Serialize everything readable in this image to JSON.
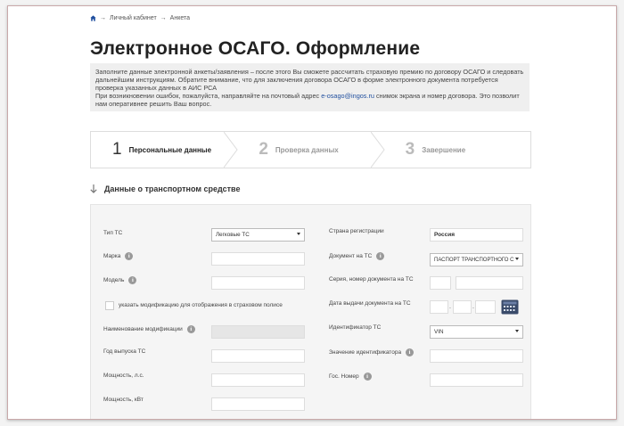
{
  "breadcrumb": {
    "separator": "→",
    "items": [
      "Личный кабинет",
      "Анкета"
    ]
  },
  "page": {
    "title": "Электронное ОСАГО. Оформление"
  },
  "notice": {
    "line1": "Заполните данные электронной анкеты/заявления – после этого Вы сможете рассчитать страховую премию по договору ОСАГО и следовать дальнейшим инструкциям. Обратите внимание, что для заключения договора ОСАГО в форме электронного документа потребуется проверка указанных данных в АИС РСА",
    "line2_prefix": "При возникновении ошибок, пожалуйста, направляйте на почтовый адрес ",
    "email": "e-osago@ingos.ru",
    "line2_suffix": " снимок экрана и номер договора. Это позволит нам оперативнее решить Ваш вопрос."
  },
  "steps": [
    {
      "num": "1",
      "label": "Персональные данные",
      "active": true
    },
    {
      "num": "2",
      "label": "Проверка данных",
      "active": false
    },
    {
      "num": "3",
      "label": "Завершение",
      "active": false
    }
  ],
  "section": {
    "title": "Данные о транспортном средстве"
  },
  "form": {
    "left": {
      "vehicle_type_label": "Тип ТС",
      "vehicle_type_value": "Легковые ТС",
      "make_label": "Марка",
      "model_label": "Модель",
      "modification_checkbox_label": "указать модификацию для отображения в страховом полисе",
      "modification_name_label": "Наименование модификации",
      "year_label": "Год выпуска ТС",
      "power_hp_label": "Мощность, л.с.",
      "power_kw_label": "Мощность, кВт"
    },
    "right": {
      "country_label": "Страна регистрации",
      "country_value": "Россия",
      "document_label": "Документ на ТС",
      "document_value": "ПАСПОРТ ТРАНСПОРТНОГО С",
      "series_number_label": "Серия, номер документа на ТС",
      "issue_date_label": "Дата выдачи документа на ТС",
      "date_separator": ".",
      "identifier_label": "Идентификатор ТС",
      "identifier_value": "VIN",
      "identifier_value_label": "Значение идентификатора",
      "plate_label": "Гос. Номер"
    },
    "info_icon_glyph": "i"
  },
  "colors": {
    "accent_link": "#1f4e9e",
    "frame_border": "#c9a9aa",
    "notice_bg": "#efefef",
    "calendar_icon": "#3a4b6a"
  }
}
